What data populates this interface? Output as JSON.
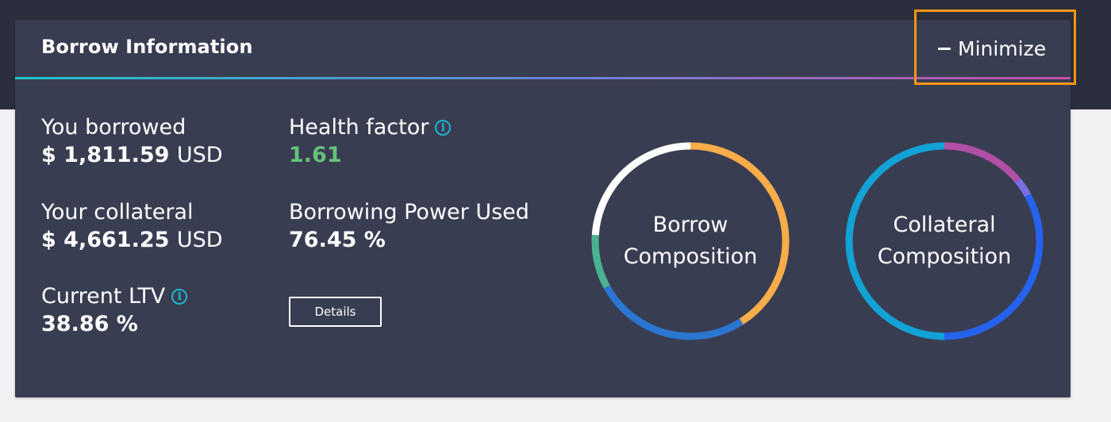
{
  "header": {
    "title": "Borrow Information",
    "minimize_label": "Minimize"
  },
  "stats": {
    "you_borrowed": {
      "label": "You borrowed",
      "value": "$ 1,811.59",
      "unit": "USD"
    },
    "your_collateral": {
      "label": "Your collateral",
      "value": "$ 4,661.25",
      "unit": "USD"
    },
    "current_ltv": {
      "label": "Current LTV",
      "value": "38.86 %"
    },
    "health_factor": {
      "label": "Health factor",
      "value": "1.61"
    },
    "borrowing_power": {
      "label": "Borrowing Power Used",
      "value": "76.45 %"
    }
  },
  "details_label": "Details",
  "colors": {
    "background": "#2b2e3d",
    "panel": "#393d51",
    "health_green": "#64c27a",
    "info_cyan": "#1fb4d4",
    "highlight": "#f4970f",
    "header_gradient": [
      "#1fc3c9",
      "#6f7fd0",
      "#c04fa5"
    ]
  },
  "borrow_composition": {
    "line1": "Borrow",
    "line2": "Composition",
    "segments": [
      {
        "fraction": 0.41,
        "color": "#f8ad4a"
      },
      {
        "fraction": 0.26,
        "color": "#2a76d0"
      },
      {
        "fraction": 0.09,
        "color": "#4ab293"
      },
      {
        "fraction": 0.24,
        "color": "#ffffff"
      }
    ]
  },
  "collateral_composition": {
    "line1": "Collateral",
    "line2": "Composition",
    "segments": [
      {
        "fraction": 0.14,
        "color": "#b04fa5"
      },
      {
        "fraction": 0.03,
        "color": "#7a6fe0"
      },
      {
        "fraction": 0.33,
        "color": "#2563ee"
      },
      {
        "fraction": 0.5,
        "color": "#12a2d6"
      }
    ]
  }
}
